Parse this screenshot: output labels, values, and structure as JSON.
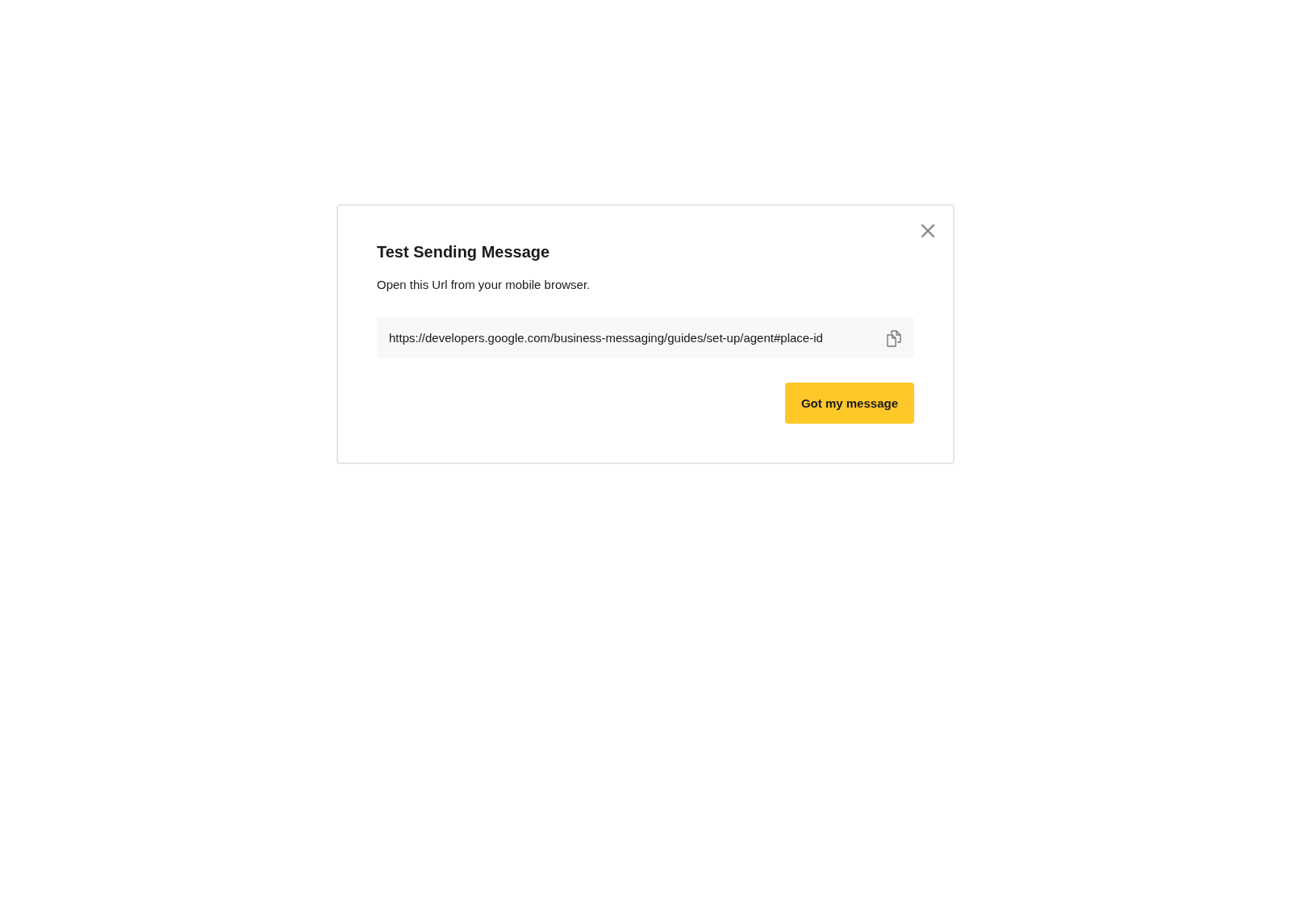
{
  "dialog": {
    "title": "Test Sending Message",
    "description": "Open this Url from your mobile browser.",
    "url": "https://developers.google.com/business-messaging/guides/set-up/agent#place-id",
    "primary_button": "Got my message"
  }
}
